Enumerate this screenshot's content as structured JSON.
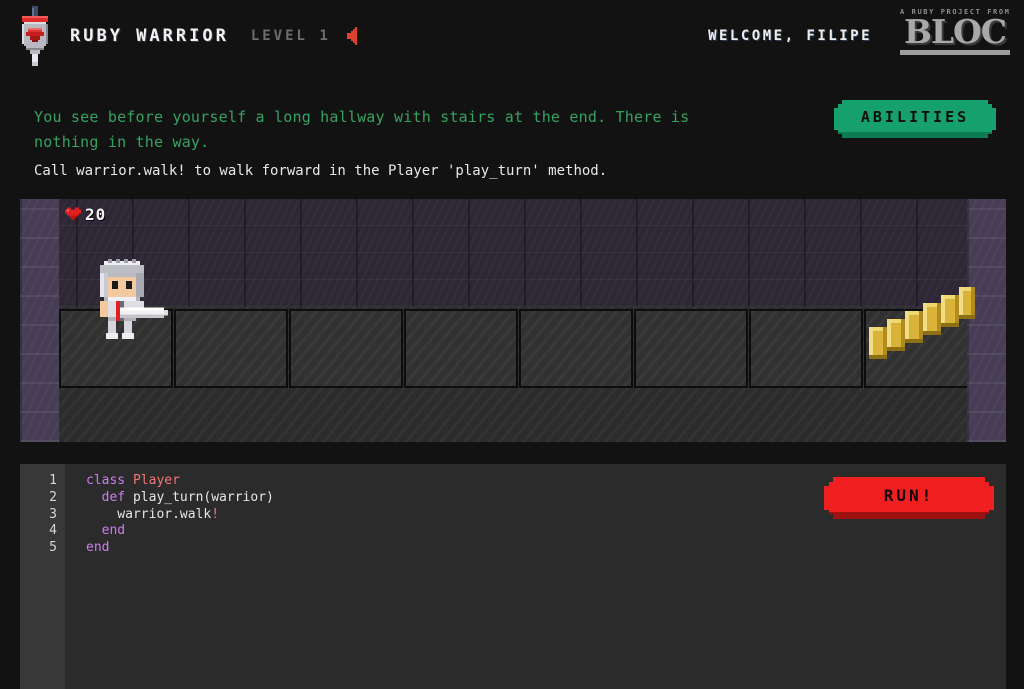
{
  "header": {
    "logo_icon": "ruby-shield-sword-icon",
    "brand_title": "RUBY WARRIOR",
    "level_label": "LEVEL 1",
    "sound_icon": "speaker-muted-icon",
    "welcome": "WELCOME, FILIPE",
    "bloc_sup": "A RUBY PROJECT FROM",
    "bloc_word": "BLOC"
  },
  "instructions": {
    "line1": "You see before yourself a long hallway with stairs at the end. There is",
    "line2": "nothing in the way.",
    "hint": "Call warrior.walk! to walk forward in the Player 'play_turn' method.",
    "text_color": "#35a35f",
    "hint_color": "#e8e8e8"
  },
  "abilities_button": {
    "label": "ABILITIES",
    "color": "#15a06e"
  },
  "board": {
    "health_icon": "heart-icon",
    "health": "20",
    "warrior_icon": "warrior-knight-icon",
    "stairs_icon": "stairs-icon",
    "tile_count": 8,
    "wall_color": "#2e2836",
    "side_wall_color": "#473d55",
    "tile_color": "#313131"
  },
  "editor": {
    "line_numbers": [
      "1",
      "2",
      "3",
      "4",
      "5"
    ],
    "lines": [
      [
        {
          "t": "class",
          "c": "kw"
        },
        {
          "t": " ",
          "c": "pun"
        },
        {
          "t": "Player",
          "c": "cls"
        }
      ],
      [
        {
          "t": "  ",
          "c": "pun"
        },
        {
          "t": "def",
          "c": "kw"
        },
        {
          "t": " play_turn(warrior)",
          "c": "pun"
        }
      ],
      [
        {
          "t": "    warrior.walk",
          "c": "pun"
        },
        {
          "t": "!",
          "c": "bang"
        }
      ],
      [
        {
          "t": "  ",
          "c": "pun"
        },
        {
          "t": "end",
          "c": "kw"
        }
      ],
      [
        {
          "t": "end",
          "c": "kw"
        }
      ]
    ],
    "background": "#2b2b2b",
    "gutter_background": "#383838"
  },
  "run_button": {
    "label": "RUN!",
    "color": "#f02020"
  }
}
